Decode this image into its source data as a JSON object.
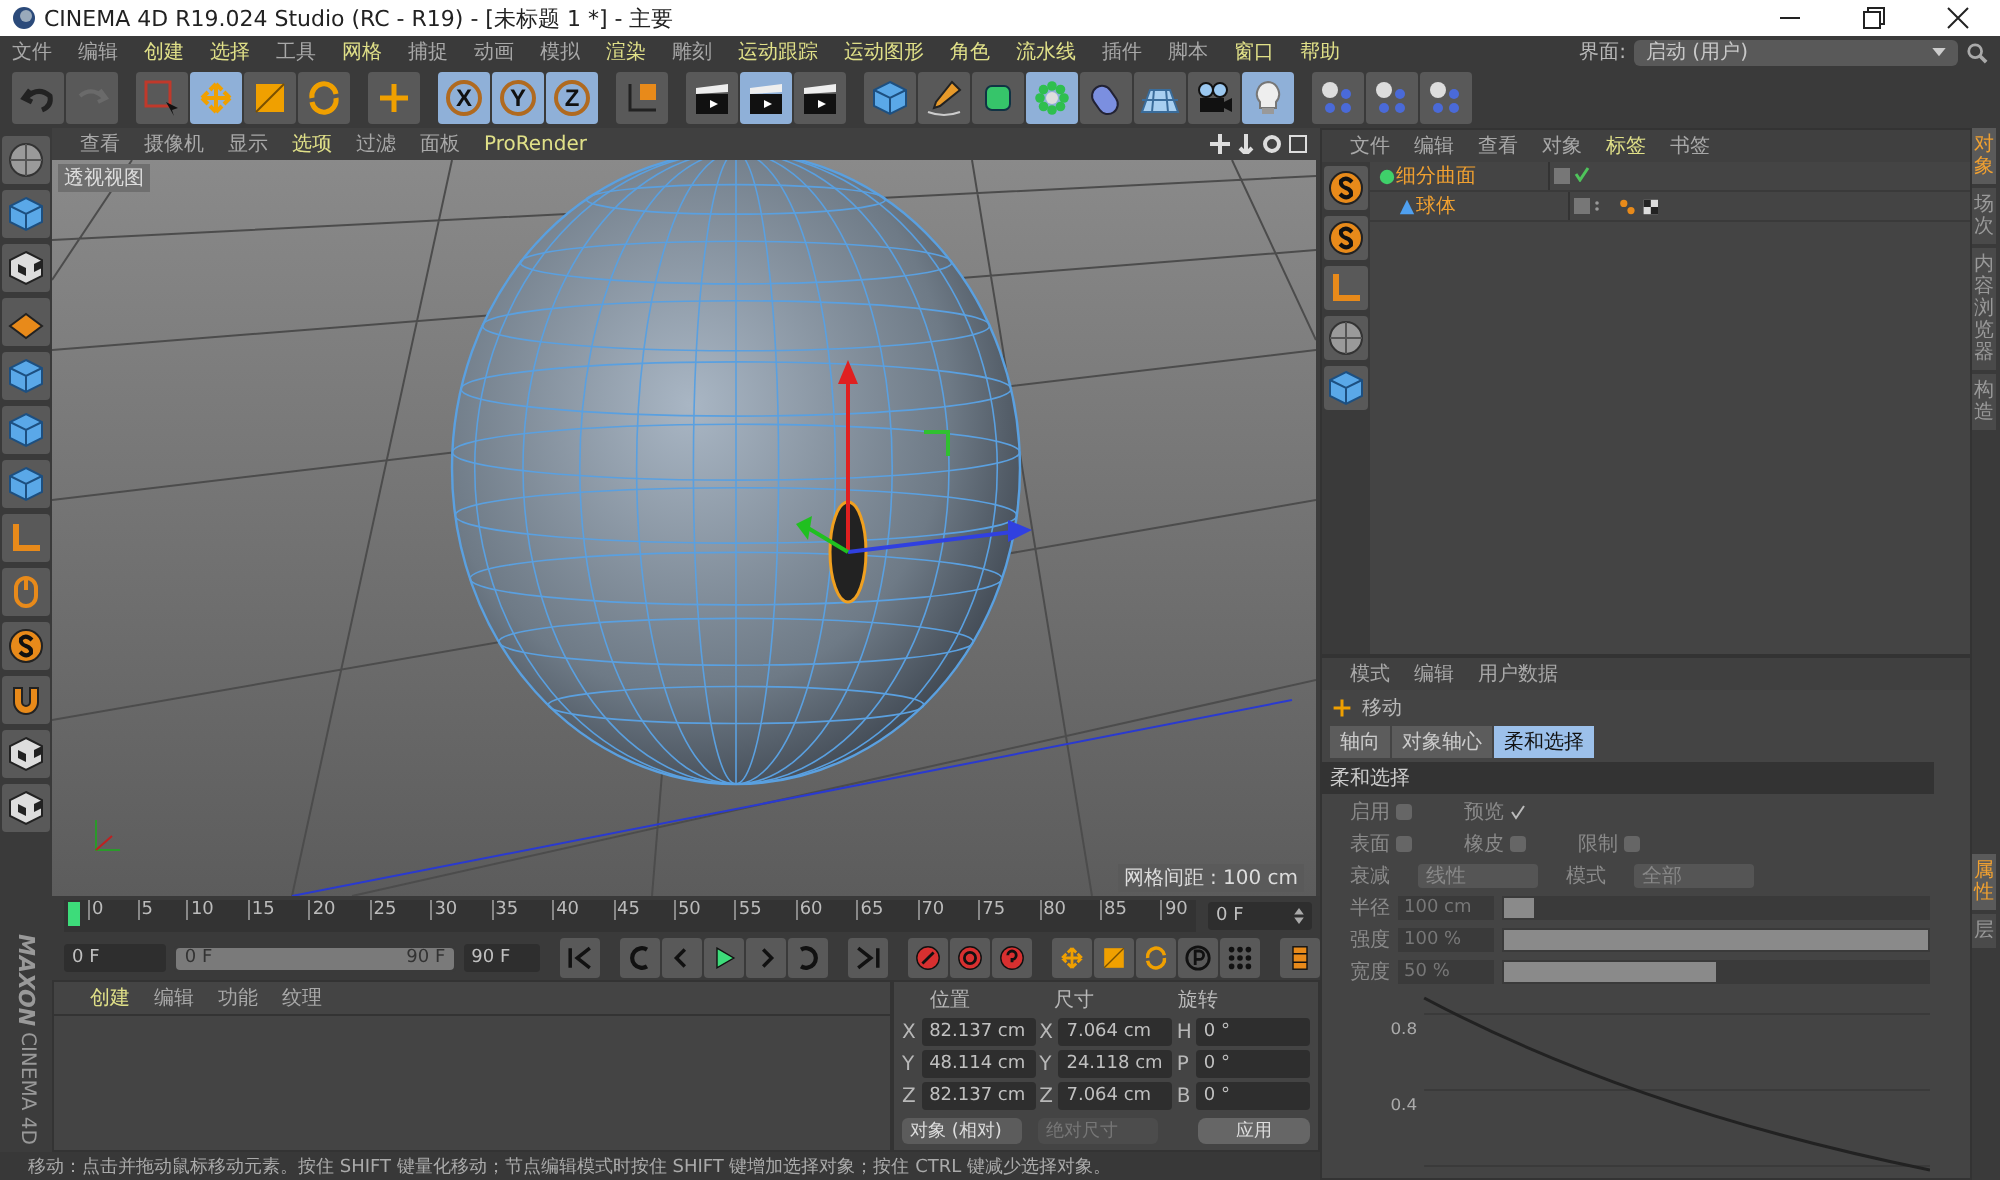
{
  "window": {
    "title": "CINEMA 4D R19.024 Studio (RC - R19) - [未标题 1 *] - 主要"
  },
  "menu": [
    {
      "label": "文件",
      "highlighted": false
    },
    {
      "label": "编辑",
      "highlighted": false
    },
    {
      "label": "创建",
      "highlighted": true
    },
    {
      "label": "选择",
      "highlighted": true
    },
    {
      "label": "工具",
      "highlighted": false
    },
    {
      "label": "网格",
      "highlighted": true
    },
    {
      "label": "捕捉",
      "highlighted": false
    },
    {
      "label": "动画",
      "highlighted": false
    },
    {
      "label": "模拟",
      "highlighted": false
    },
    {
      "label": "渲染",
      "highlighted": true
    },
    {
      "label": "雕刻",
      "highlighted": false
    },
    {
      "label": "运动跟踪",
      "highlighted": true
    },
    {
      "label": "运动图形",
      "highlighted": true
    },
    {
      "label": "角色",
      "highlighted": true
    },
    {
      "label": "流水线",
      "highlighted": true
    },
    {
      "label": "插件",
      "highlighted": false
    },
    {
      "label": "脚本",
      "highlighted": false
    },
    {
      "label": "窗口",
      "highlighted": true
    },
    {
      "label": "帮助",
      "highlighted": true
    }
  ],
  "layout_selector": {
    "label": "界面:",
    "value": "启动 (用户)"
  },
  "toolbar": [
    {
      "kind": "undo",
      "selected": false
    },
    {
      "kind": "redo",
      "selected": false
    },
    {
      "kind": "select",
      "selected": false
    },
    {
      "kind": "move",
      "selected": true
    },
    {
      "kind": "scale",
      "selected": false
    },
    {
      "kind": "rotate",
      "selected": false
    },
    {
      "kind": "plus",
      "selected": false
    },
    {
      "kind": "axis",
      "label": "X",
      "selected": true
    },
    {
      "kind": "axis",
      "label": "Y",
      "selected": true
    },
    {
      "kind": "axis",
      "label": "Z",
      "selected": true
    },
    {
      "kind": "coord",
      "selected": false
    },
    {
      "kind": "render",
      "selected": false
    },
    {
      "kind": "render",
      "selected": true
    },
    {
      "kind": "render",
      "selected": false
    },
    {
      "kind": "cube",
      "selected": false
    },
    {
      "kind": "pen",
      "selected": false
    },
    {
      "kind": "subdivide",
      "selected": false
    },
    {
      "kind": "cloner",
      "selected": true
    },
    {
      "kind": "capsule",
      "selected": false
    },
    {
      "kind": "floor",
      "selected": false
    },
    {
      "kind": "camera",
      "selected": false
    },
    {
      "kind": "light",
      "selected": true
    },
    {
      "kind": "spheres",
      "selected": false
    },
    {
      "kind": "spheres",
      "selected": false
    },
    {
      "kind": "spheres",
      "selected": false
    }
  ],
  "left_toolbar": [
    {
      "kind": "sphere"
    },
    {
      "kind": "cube"
    },
    {
      "kind": "checker"
    },
    {
      "kind": "plane"
    },
    {
      "kind": "cube"
    },
    {
      "kind": "cube"
    },
    {
      "kind": "cube"
    },
    {
      "kind": "axis"
    },
    {
      "kind": "mouse"
    },
    {
      "kind": "snap"
    },
    {
      "kind": "magnet"
    },
    {
      "kind": "checker"
    },
    {
      "kind": "checker"
    }
  ],
  "viewport": {
    "menu": [
      {
        "label": "查看",
        "highlighted": false
      },
      {
        "label": "摄像机",
        "highlighted": false
      },
      {
        "label": "显示",
        "highlighted": false
      },
      {
        "label": "选项",
        "highlighted": true
      },
      {
        "label": "过滤",
        "highlighted": false
      },
      {
        "label": "面板",
        "highlighted": false
      },
      {
        "label": "ProRender",
        "highlighted": true
      }
    ],
    "view_name": "透视视图",
    "grid_spacing": "网格间距 : 100 cm"
  },
  "timeline": {
    "ticks": [
      "0",
      "5",
      "10",
      "15",
      "20",
      "25",
      "30",
      "35",
      "40",
      "45",
      "50",
      "55",
      "60",
      "65",
      "70",
      "75",
      "80",
      "85",
      "90"
    ],
    "current": "0 F"
  },
  "transport": {
    "range_slider": {
      "level": 1
    },
    "start": "0 F",
    "range_start": "0 F",
    "range_end": "90 F",
    "end": "90 F"
  },
  "materials": {
    "menu": [
      {
        "label": "创建",
        "highlighted": true
      },
      {
        "label": "编辑",
        "highlighted": false
      },
      {
        "label": "功能",
        "highlighted": false
      },
      {
        "label": "纹理",
        "highlighted": false
      }
    ],
    "logo": [
      "MAXON",
      "CINEMA 4D"
    ]
  },
  "coordinates": {
    "headers": [
      "位置",
      "尺寸",
      "旋转"
    ],
    "rows": [
      {
        "pos_axis": "X",
        "pos": "82.137 cm",
        "size_axis": "X",
        "size": "7.064 cm",
        "rot_axis": "H",
        "rot": "0 °"
      },
      {
        "pos_axis": "Y",
        "pos": "48.114 cm",
        "size_axis": "Y",
        "size": "24.118 cm",
        "rot_axis": "P",
        "rot": "0 °"
      },
      {
        "pos_axis": "Z",
        "pos": "82.137 cm",
        "size_axis": "Z",
        "size": "7.064 cm",
        "rot_axis": "B",
        "rot": "0 °"
      }
    ],
    "mode": "对象 (相对)",
    "size_mode": "绝对尺寸",
    "apply": "应用"
  },
  "status_bar": "移动：点击并拖动鼠标移动元素。按住 SHIFT 键量化移动；节点编辑模式时按住 SHIFT 键增加选择对象；按住 CTRL 键减少选择对象。",
  "objects": {
    "menu": [
      {
        "label": "文件",
        "highlighted": false
      },
      {
        "label": "编辑",
        "highlighted": false
      },
      {
        "label": "查看",
        "highlighted": false
      },
      {
        "label": "对象",
        "highlighted": false
      },
      {
        "label": "标签",
        "highlighted": true
      },
      {
        "label": "书签",
        "highlighted": false
      }
    ],
    "tree": [
      {
        "name": "细分曲面",
        "selected": true,
        "enabled": true,
        "children": [
          {
            "name": "球体",
            "selected": true,
            "enabled": false
          }
        ]
      }
    ]
  },
  "attributes": {
    "menu": [
      "模式",
      "编辑",
      "用户数据"
    ],
    "tool": "移动",
    "tabs": [
      {
        "label": "轴向",
        "selected": false
      },
      {
        "label": "对象轴心",
        "selected": false
      },
      {
        "label": "柔和选择",
        "selected": true
      }
    ],
    "section": "柔和选择",
    "option_rows": [
      [
        {
          "label": "启用",
          "checked": false
        },
        {
          "label": "预览",
          "checked": true
        }
      ],
      [
        {
          "label": "表面",
          "checked": false
        },
        {
          "label": "橡皮",
          "checked": false
        },
        {
          "label": "限制",
          "checked": false
        }
      ]
    ],
    "dropdowns": [
      {
        "label": "衰减",
        "value": "线性"
      },
      {
        "label": "模式",
        "value": "全部"
      }
    ],
    "sliders": [
      {
        "label": "半径",
        "value": "100 cm",
        "level": 0.07
      },
      {
        "label": "强度",
        "value": "100 %",
        "level": 1.0
      },
      {
        "label": "宽度",
        "value": "50 %",
        "level": 0.5
      }
    ],
    "curve_labels": [
      "0.8",
      "0.4"
    ]
  },
  "side_tabs_top": [
    {
      "label": "对象",
      "selected": true
    },
    {
      "label": "场次",
      "selected": false
    },
    {
      "label": "内容浏览器",
      "selected": false
    },
    {
      "label": "构造",
      "selected": false
    }
  ],
  "side_tabs_bottom": [
    {
      "label": "属性",
      "selected": true
    },
    {
      "label": "层",
      "selected": false
    }
  ]
}
